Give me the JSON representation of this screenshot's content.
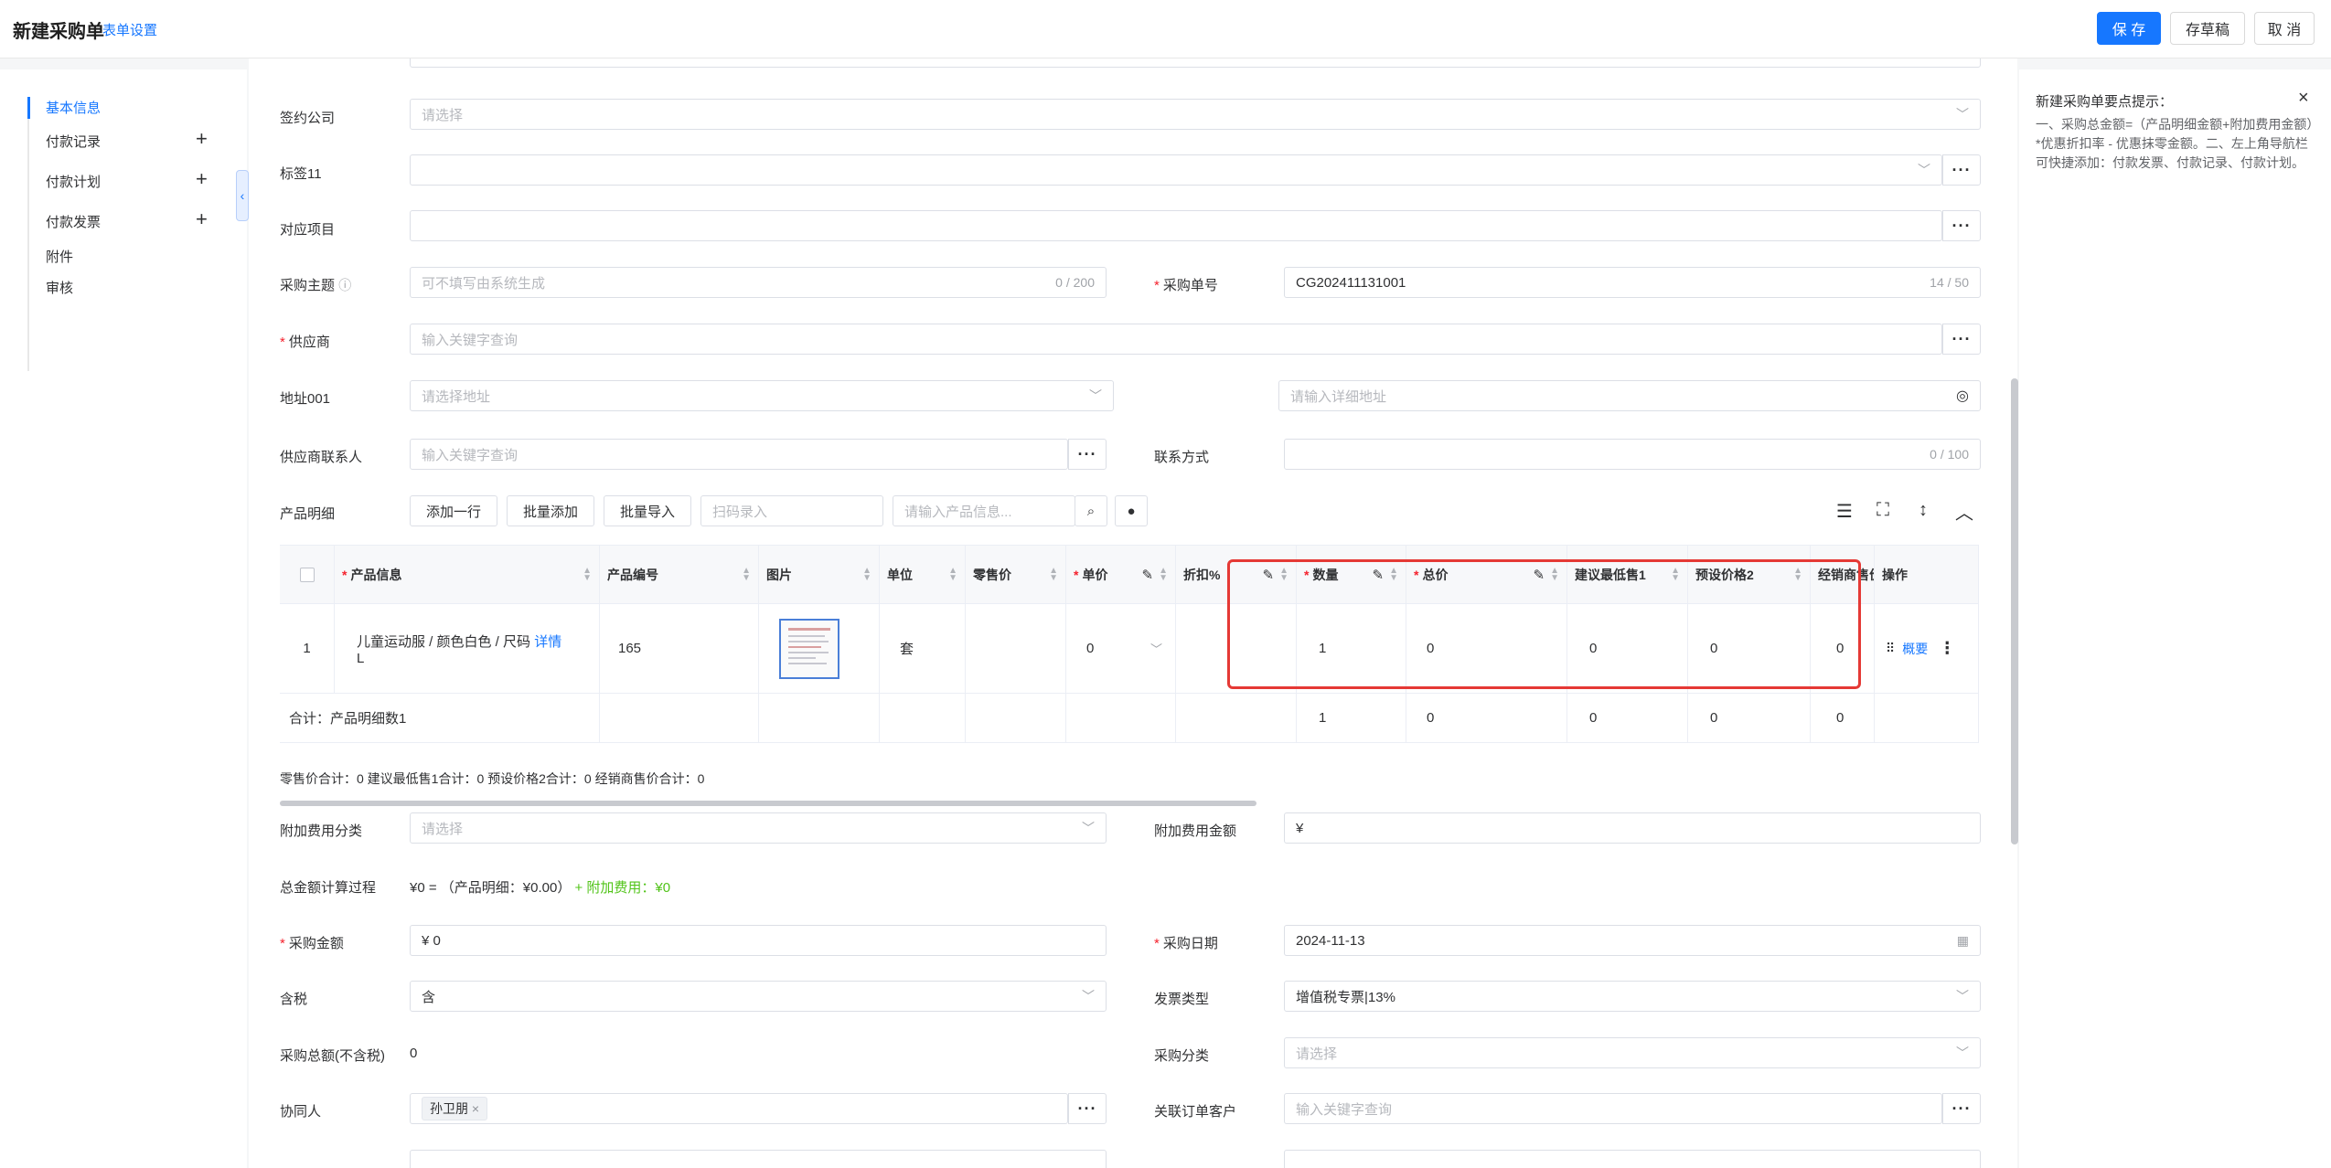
{
  "header": {
    "title": "新建采购单",
    "form_settings": "表单设置",
    "save": "保 存",
    "draft": "存草稿",
    "cancel": "取 消"
  },
  "sidebar": {
    "items": [
      {
        "label": "基本信息"
      },
      {
        "label": "付款记录"
      },
      {
        "label": "付款计划"
      },
      {
        "label": "付款发票"
      },
      {
        "label": "附件"
      },
      {
        "label": "审核"
      }
    ]
  },
  "form": {
    "sign_company": {
      "label": "签约公司",
      "placeholder": "请选择"
    },
    "tag11": {
      "label": "标签11"
    },
    "project": {
      "label": "对应项目"
    },
    "subject": {
      "label": "采购主题",
      "placeholder": "可不填写由系统生成",
      "count": "0 / 200"
    },
    "order_no": {
      "label": "采购单号",
      "value": "CG202411131001",
      "count": "14 / 50"
    },
    "supplier": {
      "label": "供应商",
      "placeholder": "输入关键字查询"
    },
    "address": {
      "label": "地址001",
      "placeholder": "请选择地址",
      "detail_placeholder": "请输入详细地址"
    },
    "supplier_contact": {
      "label": "供应商联系人",
      "placeholder": "输入关键字查询"
    },
    "contact_method": {
      "label": "联系方式",
      "count": "0 / 100"
    },
    "product_detail": {
      "label": "产品明细",
      "add_row": "添加一行",
      "batch_add": "批量添加",
      "batch_import": "批量导入",
      "scan_placeholder": "扫码录入",
      "search_placeholder": "请输入产品信息..."
    }
  },
  "table": {
    "columns": [
      "产品信息",
      "产品编号",
      "图片",
      "单位",
      "零售价",
      "单价",
      "折扣%",
      "数量",
      "总价",
      "建议最低售1",
      "预设价格2",
      "经销商售价",
      "操作"
    ],
    "row": {
      "index": "1",
      "product": "儿童运动服 / 颜色白色 / 尺码",
      "product_line2": "L",
      "detail_link": "详情",
      "code": "165",
      "unit": "套",
      "retail": "",
      "price": "0",
      "discount": "",
      "qty": "1",
      "total": "0",
      "min1": "0",
      "preset2": "0",
      "dealer": "0",
      "summary_link": "概要"
    },
    "footer": {
      "label": "合计：产品明细数1",
      "qty": "1",
      "total": "0",
      "min1": "0",
      "preset2": "0",
      "dealer": "0"
    }
  },
  "totals_line": "零售价合计：0  建议最低售1合计：0  预设价格2合计：0  经销商售价合计：0",
  "extra": {
    "fee_category": {
      "label": "附加费用分类",
      "placeholder": "请选择"
    },
    "fee_amount": {
      "label": "附加费用金额",
      "value": "¥"
    },
    "calc": {
      "label": "总金额计算过程",
      "value": "¥0 = （产品明细：¥0.00）",
      "fee": "+ 附加费用：¥0"
    },
    "purchase_amount": {
      "label": "采购金额",
      "value": "¥  0"
    },
    "purchase_date": {
      "label": "采购日期",
      "value": "2024-11-13"
    },
    "tax": {
      "label": "含税",
      "value": "含"
    },
    "invoice_type": {
      "label": "发票类型",
      "value": "增值税专票|13%"
    },
    "total_no_tax": {
      "label": "采购总额(不含税)",
      "value": "0"
    },
    "category": {
      "label": "采购分类",
      "placeholder": "请选择"
    },
    "collaborator": {
      "label": "协同人",
      "tag": "孙卫朋"
    },
    "related_customer": {
      "label": "关联订单客户",
      "placeholder": "输入关键字查询"
    }
  },
  "tips": {
    "title": "新建采购单要点提示：",
    "text": "一、采购总金额=（产品明细金额+附加费用金额）*优惠折扣率 - 优惠抹零金额。二、左上角导航栏可快捷添加：付款发票、付款记录、付款计划。"
  }
}
